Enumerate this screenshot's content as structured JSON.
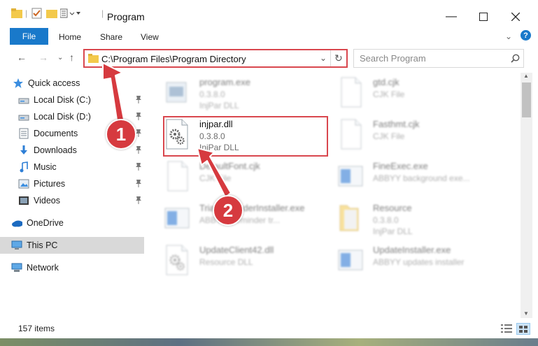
{
  "window": {
    "title": "Program"
  },
  "ribbon": {
    "tabs": [
      "File",
      "Home",
      "Share",
      "View"
    ]
  },
  "nav": {
    "address": "C:\\Program Files\\Program Directory",
    "search_placeholder": "Search Program"
  },
  "sidebar": {
    "items": [
      {
        "label": "Quick access",
        "icon": "star-icon",
        "pinned": false
      },
      {
        "label": "Local Disk (C:)",
        "icon": "drive-icon",
        "pinned": true
      },
      {
        "label": "Local Disk (D:)",
        "icon": "drive-icon",
        "pinned": true
      },
      {
        "label": "Documents",
        "icon": "documents-icon",
        "pinned": true
      },
      {
        "label": "Downloads",
        "icon": "download-icon",
        "pinned": true
      },
      {
        "label": "Music",
        "icon": "music-icon",
        "pinned": true
      },
      {
        "label": "Pictures",
        "icon": "pictures-icon",
        "pinned": true
      },
      {
        "label": "Videos",
        "icon": "videos-icon",
        "pinned": true
      },
      {
        "label": "OneDrive",
        "icon": "cloud-icon",
        "pinned": false
      },
      {
        "label": "This PC",
        "icon": "pc-icon",
        "pinned": false,
        "selected": true
      },
      {
        "label": "Network",
        "icon": "network-icon",
        "pinned": false
      }
    ]
  },
  "files": [
    {
      "name": "program.exe",
      "line1": "0.3.8.0",
      "line2": "InjPar DLL",
      "icon": "exe-icon",
      "blurred": true
    },
    {
      "name": "gtd.cjk",
      "line1": "CJK File",
      "line2": "",
      "icon": "file-icon",
      "blurred": true
    },
    {
      "name": "injpar.dll",
      "line1": "0.3.8.0",
      "line2": "InjPar DLL",
      "icon": "dll-gear-icon",
      "blurred": false
    },
    {
      "name": "Fasthmt.cjk",
      "line1": "CJK File",
      "line2": "",
      "icon": "file-icon",
      "blurred": true
    },
    {
      "name": "DefaultFont.cjk",
      "line1": "CJK File",
      "line2": "",
      "icon": "file-icon",
      "blurred": true
    },
    {
      "name": "FineExec.exe",
      "line1": "ABBYY background exe...",
      "line2": "",
      "icon": "app-icon",
      "blurred": true
    },
    {
      "name": "TrialReminderInstaller.exe",
      "line1": "ABBYY Reminder tr...",
      "line2": "",
      "icon": "app-icon",
      "blurred": true
    },
    {
      "name": "Resource",
      "line1": "0.3.8.0",
      "line2": "InjPar DLL",
      "icon": "folder-icon",
      "blurred": true
    },
    {
      "name": "UpdateClient42.dll",
      "line1": "Resource DLL",
      "line2": "",
      "icon": "dll-gear-icon",
      "blurred": true
    },
    {
      "name": "UpdateInstaller.exe",
      "line1": "ABBYY updates installer",
      "line2": "",
      "icon": "app-icon",
      "blurred": true
    }
  ],
  "status": {
    "items_count": "157 items"
  },
  "annotations": {
    "badge1": "1",
    "badge2": "2",
    "color": "#d63a3f"
  }
}
